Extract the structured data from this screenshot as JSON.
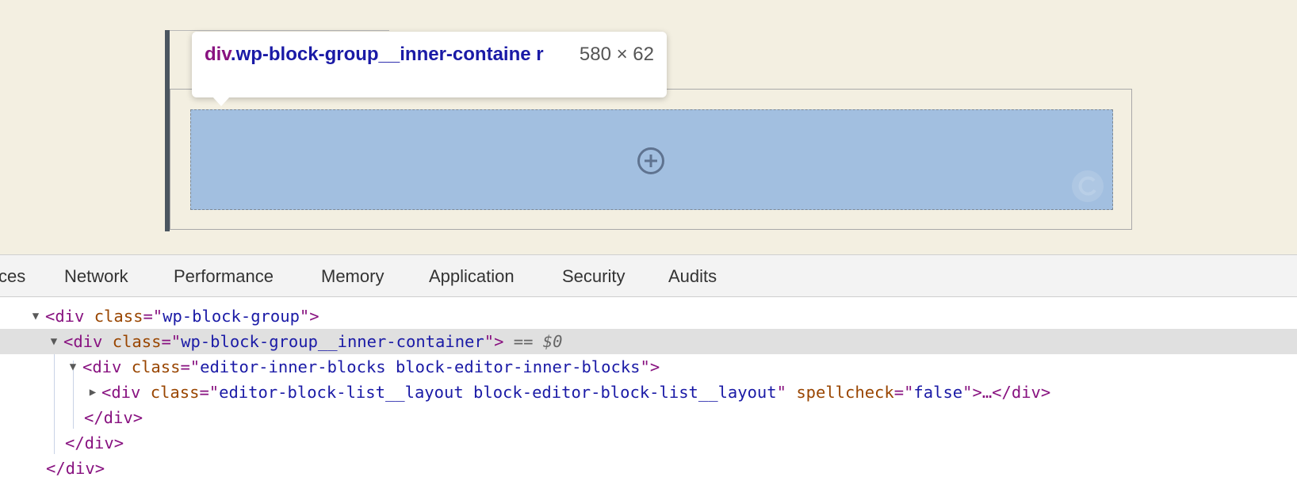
{
  "tooltip": {
    "tag": "div",
    "class_name": ".wp-block-group__inner-containe r",
    "size": "580 × 62"
  },
  "tabs": [
    "ces",
    "Network",
    "Performance",
    "Memory",
    "Application",
    "Security",
    "Audits"
  ],
  "tree": {
    "line1": {
      "tag_open": "<div",
      "attr": "class",
      "value": "wp-block-group",
      "close": ">"
    },
    "line2": {
      "tag_open": "<div",
      "attr": "class",
      "value": "wp-block-group__inner-container",
      "close": ">",
      "marker": "== $0"
    },
    "line3": {
      "tag_open": "<div",
      "attr": "class",
      "value": "editor-inner-blocks block-editor-inner-blocks",
      "close": ">"
    },
    "line4": {
      "tag_open": "<div",
      "attr": "class",
      "value": "editor-block-list__layout block-editor-block-list__layout",
      "attr2": "spellcheck",
      "value2": "false",
      "close": ">…</div>"
    },
    "line5": "</div>",
    "line6": "</div>",
    "line7": "</div>"
  },
  "colors": {
    "preview_bg": "#f3efe1",
    "inner_container_highlight": "#a2bfe0",
    "tag": "#881280",
    "attr_name": "#994500",
    "attr_value": "#1a1aa6"
  },
  "icons": [
    "plus-circle-icon",
    "block-icon",
    "expand-triangle-icon",
    "collapse-triangle-icon"
  ]
}
